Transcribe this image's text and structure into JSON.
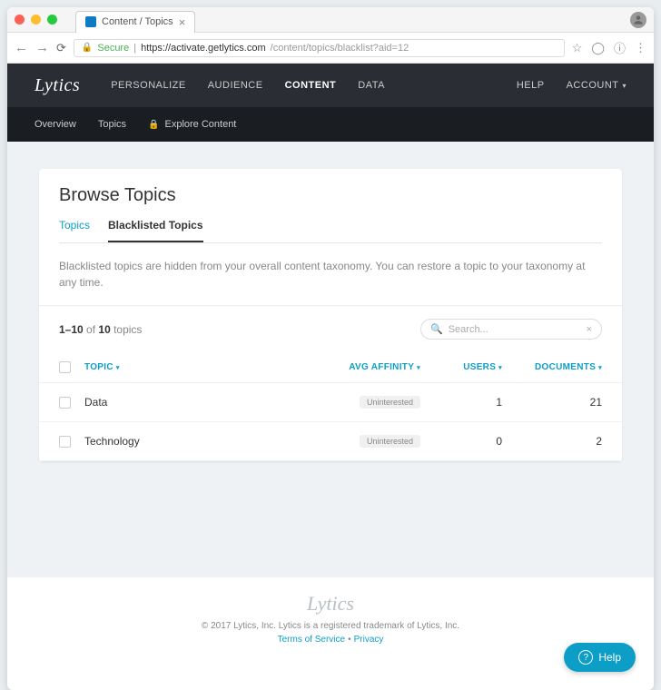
{
  "browser": {
    "tab_title": "Content / Topics",
    "secure_label": "Secure",
    "url_domain": "https://activate.getlytics.com",
    "url_path": "/content/topics/blacklist?aid=12"
  },
  "header": {
    "logo": "Lytics",
    "nav": [
      "PERSONALIZE",
      "AUDIENCE",
      "CONTENT",
      "DATA"
    ],
    "help": "HELP",
    "account": "ACCOUNT"
  },
  "subheader": {
    "items": [
      "Overview",
      "Topics"
    ],
    "explore": "Explore Content"
  },
  "panel": {
    "title": "Browse Topics",
    "tabs": [
      "Topics",
      "Blacklisted Topics"
    ],
    "description": "Blacklisted topics are hidden from your overall content taxonomy. You can restore a topic to your taxonomy at any time.",
    "count_range": "1–10",
    "count_of": " of ",
    "count_total": "10",
    "count_label": " topics",
    "search_placeholder": "Search..."
  },
  "table": {
    "headers": {
      "topic": "TOPIC",
      "affinity": "AVG AFFINITY",
      "users": "USERS",
      "documents": "DOCUMENTS"
    },
    "rows": [
      {
        "topic": "Data",
        "affinity_label": "Uninterested",
        "users": "1",
        "documents": "21"
      },
      {
        "topic": "Technology",
        "affinity_label": "Uninterested",
        "users": "0",
        "documents": "2"
      }
    ]
  },
  "footer": {
    "logo": "Lytics",
    "copyright": "© 2017 Lytics, Inc. Lytics is a registered trademark of Lytics, Inc.",
    "terms": "Terms of Service",
    "privacy": "Privacy",
    "help": "Help"
  }
}
